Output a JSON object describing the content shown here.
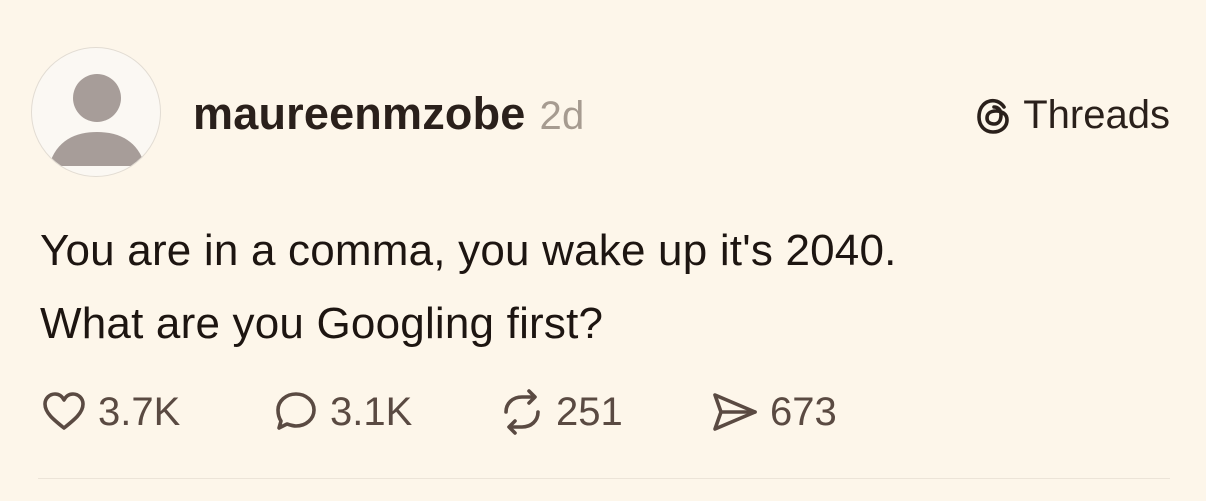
{
  "post": {
    "username": "maureenmzobe",
    "time_ago": "2d",
    "brand_label": "Threads",
    "text_lines": [
      "You are in a comma, you wake up it's 2040.",
      "What are you Googling first?"
    ],
    "stats": {
      "likes": "3.7K",
      "replies": "3.1K",
      "reposts": "251",
      "shares": "673"
    }
  },
  "icons": {
    "avatar": "default-avatar-icon",
    "brand": "threads-logo-icon",
    "like": "heart-icon",
    "reply": "speech-bubble-icon",
    "repost": "repost-arrows-icon",
    "share": "paper-plane-icon"
  },
  "colors": {
    "background": "#fdf6ea",
    "text": "#1d1511",
    "muted": "#a69b90",
    "icon": "#5a4a42"
  }
}
